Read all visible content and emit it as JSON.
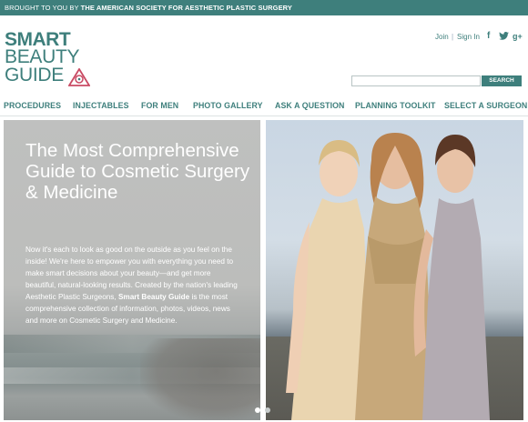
{
  "topbar": {
    "prefix": "BROUGHT TO YOU BY ",
    "org": "THE AMERICAN SOCIETY FOR AESTHETIC PLASTIC SURGERY"
  },
  "logo": {
    "line1": "SMART",
    "line2": "BEAUTY",
    "line3": "GUIDE"
  },
  "utility": {
    "join": "Join",
    "separator": "|",
    "sign_in": "Sign In",
    "social": {
      "facebook": "f",
      "twitter": "twitter-icon",
      "google_plus": "g+"
    }
  },
  "search": {
    "value": "",
    "placeholder": "",
    "button_label": "SEARCH"
  },
  "nav": [
    "PROCEDURES",
    "INJECTABLES",
    "FOR MEN",
    "PHOTO GALLERY",
    "ASK A QUESTION",
    "PLANNING TOOLKIT",
    "SELECT A SURGEON"
  ],
  "hero": {
    "title": "The Most Comprehensive Guide to Cosmetic Surgery & Medicine",
    "body_part1": "Now it's each to look as good on the outside as you feel on the inside! We're here to empower you with everything you need to make smart decisions about your beauty—and get more beautiful, natural-looking results. Created by the nation's leading Aesthetic Plastic Surgeons, ",
    "body_bold": "Smart Beauty Guide",
    "body_part2": " is the most comprehensive collection of information, photos, videos, news and more on Cosmetic Surgery and Medicine."
  },
  "carousel": {
    "current_slide": 1,
    "total_slides": 2
  },
  "colors": {
    "brand_teal": "#3e7f7c",
    "logo_accent": "#c94a63"
  }
}
